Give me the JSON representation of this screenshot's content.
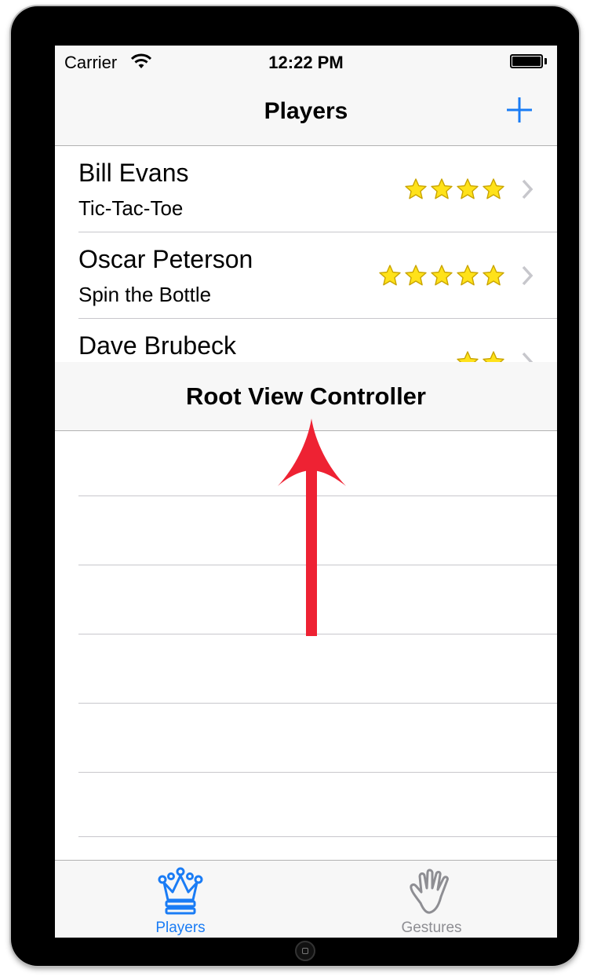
{
  "status_bar": {
    "carrier": "Carrier",
    "time": "12:22 PM",
    "wifi_icon": "wifi-icon",
    "battery_icon": "battery-icon"
  },
  "nav_bar": {
    "title": "Players",
    "add_icon": "plus-icon"
  },
  "players": [
    {
      "name": "Bill Evans",
      "game": "Tic-Tac-Toe",
      "rating": 4
    },
    {
      "name": "Oscar Peterson",
      "game": "Spin the Bottle",
      "rating": 5
    },
    {
      "name": "Dave Brubeck",
      "game": "",
      "rating": 2
    }
  ],
  "overlay": {
    "title": "Root View Controller"
  },
  "tab_bar": {
    "tabs": [
      {
        "label": "Players",
        "icon": "crown-icon",
        "selected": true
      },
      {
        "label": "Gestures",
        "icon": "hand-icon",
        "selected": false
      }
    ]
  },
  "colors": {
    "tint": "#1a7cf5",
    "inactive_tab": "#8e8e93",
    "star": "#ffe21a",
    "star_outline": "#c9a400",
    "arrow": "#ee2233",
    "chevron": "#c7c7cc"
  }
}
